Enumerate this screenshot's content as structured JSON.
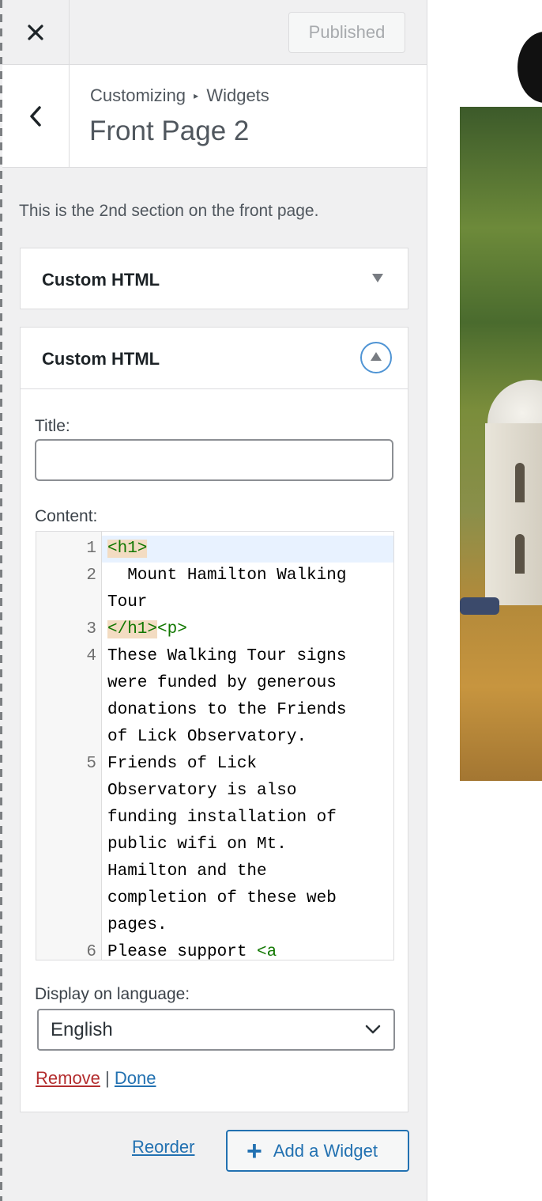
{
  "header": {
    "close_icon": "close-icon",
    "publish_label": "Published"
  },
  "section": {
    "breadcrumb": [
      "Customizing",
      "Widgets"
    ],
    "breadcrumb_separator": "▸",
    "title": "Front Page 2",
    "description": "This is the 2nd section on the front page."
  },
  "widgets": [
    {
      "title": "Custom HTML",
      "expanded": false
    },
    {
      "title": "Custom HTML",
      "expanded": true,
      "title_label": "Title:",
      "title_value": "",
      "content_label": "Content:",
      "code_lines": [
        {
          "num": "1",
          "rows": [
            [
              {
                "t": "<h1>",
                "c": "tag-hl"
              }
            ]
          ]
        },
        {
          "num": "2",
          "rows": [
            [
              {
                "t": "  Mount Hamilton Walking",
                "c": ""
              }
            ],
            [
              {
                "t": "Tour",
                "c": ""
              }
            ]
          ]
        },
        {
          "num": "3",
          "rows": [
            [
              {
                "t": "</h1>",
                "c": "tag-hl"
              },
              {
                "t": "<p>",
                "c": "tag"
              }
            ]
          ]
        },
        {
          "num": "4",
          "rows": [
            [
              {
                "t": "These Walking Tour signs",
                "c": ""
              }
            ],
            [
              {
                "t": "were funded by generous",
                "c": ""
              }
            ],
            [
              {
                "t": "donations to the Friends",
                "c": ""
              }
            ],
            [
              {
                "t": "of Lick Observatory.",
                "c": ""
              }
            ]
          ]
        },
        {
          "num": "5",
          "rows": [
            [
              {
                "t": "Friends of Lick",
                "c": ""
              }
            ],
            [
              {
                "t": "Observatory is also",
                "c": ""
              }
            ],
            [
              {
                "t": "funding installation of",
                "c": ""
              }
            ],
            [
              {
                "t": "public wifi on Mt.",
                "c": ""
              }
            ],
            [
              {
                "t": "Hamilton and the",
                "c": ""
              }
            ],
            [
              {
                "t": "completion of these web",
                "c": ""
              }
            ],
            [
              {
                "t": "pages.",
                "c": ""
              }
            ]
          ]
        },
        {
          "num": "6",
          "rows": [
            [
              {
                "t": "Please support ",
                "c": ""
              },
              {
                "t": "<a",
                "c": "tag"
              }
            ]
          ]
        }
      ],
      "language_label": "Display on language:",
      "language_value": "English",
      "remove_label": "Remove",
      "actions_separator": "|",
      "done_label": "Done"
    }
  ],
  "footer": {
    "reorder_label": "Reorder",
    "add_widget_label": "Add a Widget"
  },
  "colors": {
    "link": "#2271b1",
    "remove": "#b32d2e",
    "code_tag": "#117700"
  }
}
